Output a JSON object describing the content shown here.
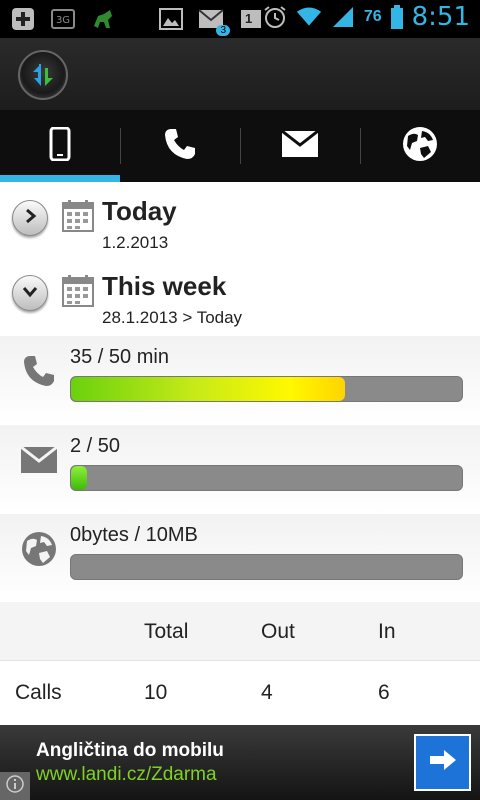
{
  "status_bar": {
    "battery_text": "76",
    "time": "8:51",
    "notification_badge": "3",
    "calendar_badge": "1",
    "network_label": "3G",
    "accent": "#33b5e5"
  },
  "tabs": [
    {
      "icon": "phone-device-icon",
      "active": true
    },
    {
      "icon": "call-icon",
      "active": false
    },
    {
      "icon": "mail-icon",
      "active": false
    },
    {
      "icon": "globe-icon",
      "active": false
    }
  ],
  "periods": [
    {
      "title": "Today",
      "subtitle": "1.2.2013",
      "expanded": false
    },
    {
      "title": "This week",
      "subtitle": "28.1.2013 > Today",
      "expanded": true
    }
  ],
  "usage": {
    "calls": {
      "label": "35 / 50 min",
      "used": 35,
      "limit": 50
    },
    "sms": {
      "label": "2 / 50",
      "used": 2,
      "limit": 50
    },
    "data": {
      "label": "0bytes / 10MB",
      "used": 0,
      "limit": 10
    }
  },
  "stats": {
    "headers": [
      "",
      "Total",
      "Out",
      "In"
    ],
    "rows": [
      {
        "label": "Calls",
        "total": "10",
        "out": "4",
        "in": "6"
      }
    ]
  },
  "ad": {
    "title": "Angličtina do mobilu",
    "link": "www.landi.cz/Zdarma",
    "info_icon": "info-icon",
    "button_icon": "arrow-right-icon"
  }
}
